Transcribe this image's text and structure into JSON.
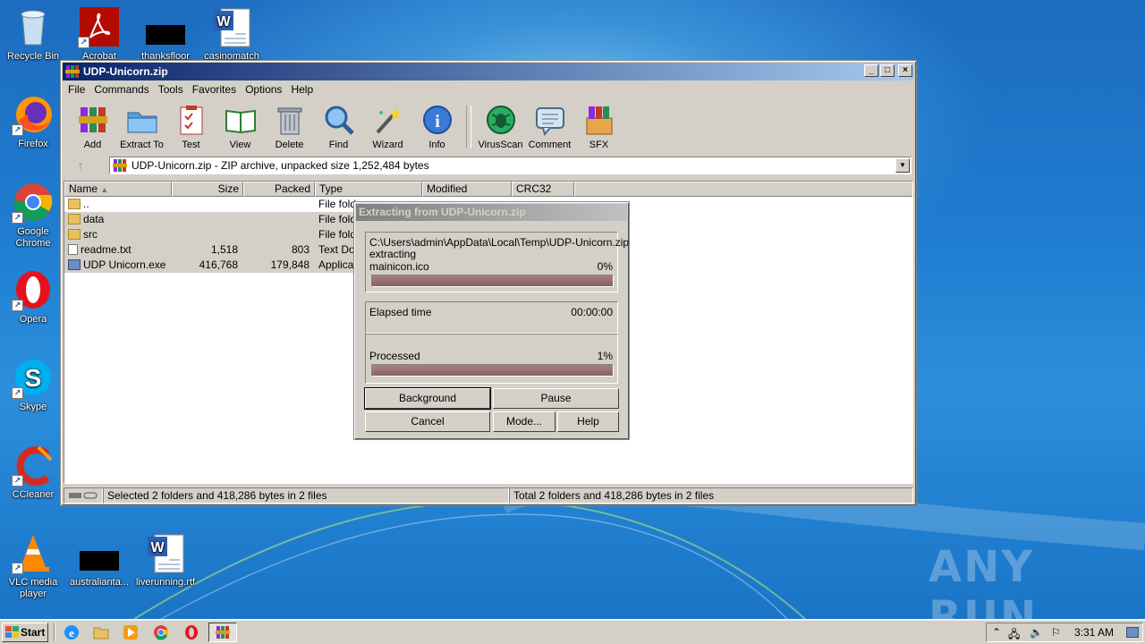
{
  "desktop": {
    "icons": [
      {
        "label": "Recycle Bin"
      },
      {
        "label": "Acrobat"
      },
      {
        "label": "thanksfloor"
      },
      {
        "label": "casinomatch"
      },
      {
        "label": "Firefox"
      },
      {
        "label": "Google Chrome"
      },
      {
        "label": "Opera"
      },
      {
        "label": "Skype"
      },
      {
        "label": "CCleaner"
      },
      {
        "label": "VLC media player"
      },
      {
        "label": "australianta..."
      },
      {
        "label": "liverunning.rtf"
      }
    ],
    "watermark": "ANY RUN"
  },
  "window": {
    "title": "UDP-Unicorn.zip",
    "controls": {
      "minimize": "_",
      "maximize": "□",
      "close": "×"
    },
    "menu": [
      "File",
      "Commands",
      "Tools",
      "Favorites",
      "Options",
      "Help"
    ],
    "toolbar": [
      {
        "label": "Add",
        "icon": "add-archive-icon"
      },
      {
        "label": "Extract To",
        "icon": "extract-folder-icon"
      },
      {
        "label": "Test",
        "icon": "test-clipboard-icon"
      },
      {
        "label": "View",
        "icon": "view-book-icon"
      },
      {
        "label": "Delete",
        "icon": "trash-can-icon"
      },
      {
        "label": "Find",
        "icon": "magnifier-icon"
      },
      {
        "label": "Wizard",
        "icon": "magic-wand-icon"
      },
      {
        "label": "Info",
        "icon": "info-icon"
      },
      {
        "label": "VirusScan",
        "icon": "virus-bug-icon"
      },
      {
        "label": "Comment",
        "icon": "comment-icon"
      },
      {
        "label": "SFX",
        "icon": "sfx-box-icon"
      }
    ],
    "address": "UDP-Unicorn.zip - ZIP archive, unpacked size 1,252,484 bytes",
    "columns": [
      "Name",
      "Size",
      "Packed",
      "Type",
      "Modified",
      "CRC32"
    ],
    "files": [
      {
        "name": "..",
        "size": "",
        "packed": "",
        "type": "File fold",
        "modified": "",
        "crc": ""
      },
      {
        "name": "data",
        "size": "",
        "packed": "",
        "type": "File fold",
        "modified": "",
        "crc": ""
      },
      {
        "name": "src",
        "size": "",
        "packed": "",
        "type": "File fold",
        "modified": "",
        "crc": ""
      },
      {
        "name": "readme.txt",
        "size": "1,518",
        "packed": "803",
        "type": "Text Do",
        "modified": "",
        "crc": ""
      },
      {
        "name": "UDP Unicorn.exe",
        "size": "416,768",
        "packed": "179,848",
        "type": "Applicat",
        "modified": "",
        "crc": ""
      }
    ],
    "status_left": "Selected 2 folders and 418,286 bytes in 2 files",
    "status_right": "Total 2 folders and 418,286 bytes in 2 files"
  },
  "dialog": {
    "title": "Extracting from UDP-Unicorn.zip",
    "path": "C:\\Users\\admin\\AppData\\Local\\Temp\\UDP-Unicorn.zip",
    "action": "extracting",
    "current_file": "mainicon.ico",
    "file_percent": "0%",
    "file_progress": 0,
    "elapsed_label": "Elapsed time",
    "elapsed_value": "00:00:00",
    "processed_label": "Processed",
    "processed_percent": "1%",
    "processed_progress": 0.01,
    "buttons": {
      "background": "Background",
      "pause": "Pause",
      "cancel": "Cancel",
      "mode": "Mode...",
      "help": "Help"
    }
  },
  "taskbar": {
    "start": "Start",
    "clock": "3:31 AM",
    "quick_launch": [
      "ie-icon",
      "explorer-icon",
      "media-player-icon",
      "chrome-icon",
      "opera-icon",
      "winrar-icon"
    ]
  }
}
